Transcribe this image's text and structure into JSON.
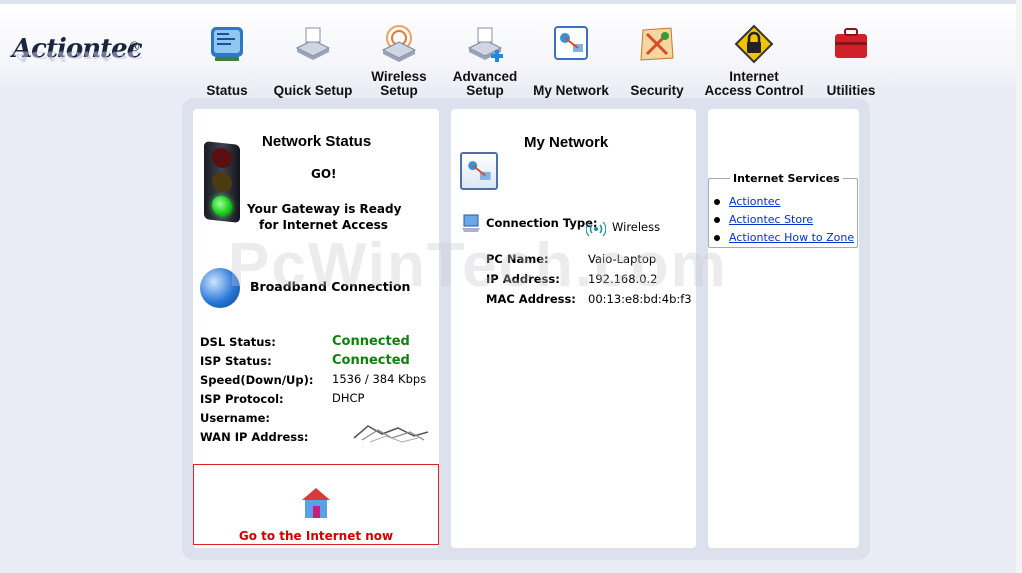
{
  "brand": {
    "name": "Actiontec",
    "registered": "®"
  },
  "nav": [
    {
      "id": "status",
      "label": "Status",
      "icon": "status-monitor-icon",
      "color": "#3a8fd6"
    },
    {
      "id": "quick-setup",
      "label": "Quick Setup",
      "icon": "router-quick-setup-icon",
      "color": "#7a8aa6"
    },
    {
      "id": "wireless-setup",
      "label": "Wireless Setup",
      "icon": "wireless-router-icon",
      "color": "#e07a30"
    },
    {
      "id": "advanced-setup",
      "label": "Advanced Setup",
      "icon": "router-advanced-setup-icon",
      "color": "#2e86d6"
    },
    {
      "id": "my-network",
      "label": "My Network",
      "icon": "network-map-icon",
      "color": "#3a70c0"
    },
    {
      "id": "security",
      "label": "Security",
      "icon": "security-map-icon",
      "color": "#d84b2a"
    },
    {
      "id": "internet-access-control",
      "label": "Internet Access Control",
      "icon": "lock-warning-sign-icon",
      "color": "#f2c400"
    },
    {
      "id": "utilities",
      "label": "Utilities",
      "icon": "toolbox-icon",
      "color": "#d0202a"
    }
  ],
  "network_status": {
    "title": "Network Status",
    "state": "GO!",
    "message_line1": "Your Gateway is Ready",
    "message_line2": "for Internet Access",
    "broadband_title": "Broadband Connection",
    "rows": [
      {
        "label": "DSL Status:",
        "value": "Connected",
        "highlight": true
      },
      {
        "label": "ISP Status:",
        "value": "Connected",
        "highlight": true
      },
      {
        "label": "Speed(Down/Up):",
        "value": "1536 / 384 Kbps",
        "highlight": false
      },
      {
        "label": "ISP Protocol:",
        "value": "DHCP",
        "highlight": false
      },
      {
        "label": "Username:",
        "value": "",
        "highlight": false
      },
      {
        "label": "WAN IP Address:",
        "value": "",
        "highlight": false
      }
    ],
    "go_internet": "Go to the Internet now"
  },
  "my_network": {
    "title": "My Network",
    "connection_type_label": "Connection Type:",
    "connection_type_value": "Wireless",
    "rows": [
      {
        "label": "PC Name:",
        "value": "Vaio-Laptop"
      },
      {
        "label": "IP Address:",
        "value": "192.168.0.2"
      },
      {
        "label": "MAC Address:",
        "value": "00:13:e8:bd:4b:f3"
      }
    ]
  },
  "internet_services": {
    "title": "Internet Services",
    "links": [
      "Actiontec",
      "Actiontec Store",
      "Actiontec How to Zone"
    ]
  },
  "watermark": "PcWinTech.com",
  "colors": {
    "accent_green": "#108010",
    "link_blue": "#0033cc",
    "alert_red": "#d10000"
  }
}
